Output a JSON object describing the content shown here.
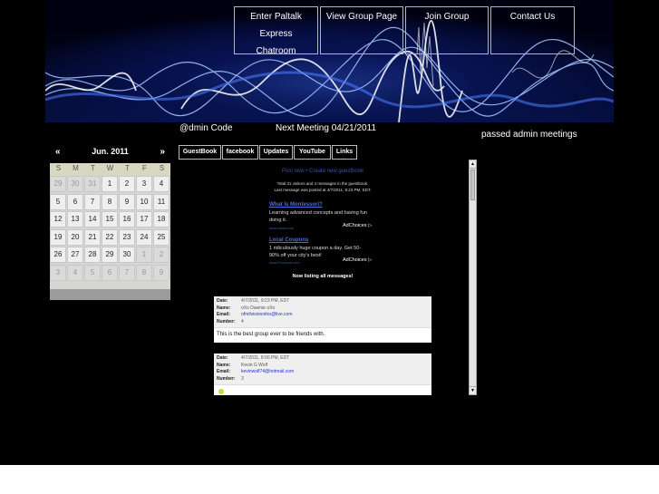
{
  "nav": [
    {
      "line1": "Enter Paltalk Express",
      "line2": "Chatroom"
    },
    {
      "line1": "View Group Page",
      "line2": ""
    },
    {
      "line1": "Join Group",
      "line2": ""
    },
    {
      "line1": "Contact Us",
      "line2": ""
    }
  ],
  "calendar": {
    "prev": "«",
    "next": "»",
    "title": "Jun. 2011",
    "weekdays": [
      "S",
      "M",
      "T",
      "W",
      "T",
      "F",
      "S"
    ],
    "weeks": [
      [
        {
          "d": "29",
          "o": true
        },
        {
          "d": "30",
          "o": true
        },
        {
          "d": "31",
          "o": true
        },
        {
          "d": "1"
        },
        {
          "d": "2"
        },
        {
          "d": "3"
        },
        {
          "d": "4"
        }
      ],
      [
        {
          "d": "5"
        },
        {
          "d": "6"
        },
        {
          "d": "7"
        },
        {
          "d": "8"
        },
        {
          "d": "9"
        },
        {
          "d": "10"
        },
        {
          "d": "11"
        }
      ],
      [
        {
          "d": "12"
        },
        {
          "d": "13"
        },
        {
          "d": "14"
        },
        {
          "d": "15"
        },
        {
          "d": "16"
        },
        {
          "d": "17"
        },
        {
          "d": "18"
        }
      ],
      [
        {
          "d": "19"
        },
        {
          "d": "20"
        },
        {
          "d": "21"
        },
        {
          "d": "22"
        },
        {
          "d": "23"
        },
        {
          "d": "24"
        },
        {
          "d": "25"
        }
      ],
      [
        {
          "d": "26"
        },
        {
          "d": "27"
        },
        {
          "d": "28"
        },
        {
          "d": "29"
        },
        {
          "d": "30"
        },
        {
          "d": "1",
          "o": true
        },
        {
          "d": "2",
          "o": true
        }
      ],
      [
        {
          "d": "3",
          "o": true
        },
        {
          "d": "4",
          "o": true
        },
        {
          "d": "5",
          "o": true
        },
        {
          "d": "6",
          "o": true
        },
        {
          "d": "7",
          "o": true
        },
        {
          "d": "8",
          "o": true
        },
        {
          "d": "9",
          "o": true
        }
      ]
    ]
  },
  "header": {
    "admin_code": "@dmin Code",
    "next_meeting": "Next Meeting 04/21/2011",
    "passed": "passed admin meetings"
  },
  "tabs": [
    "GuestBook",
    "facebook",
    "Updates",
    "YouTube",
    "Links"
  ],
  "guestbook": {
    "post_now": "Post now",
    "separator": " • ",
    "create_new": "Create new guestbook",
    "total_line": "Total 31 visitors and 4 messages in the guestbook.",
    "last_line": "Last message was posted at 4/7/2011, 9:23 PM, EDT.",
    "ads": [
      {
        "title": "What Is Montessori?",
        "body": "Learning advanced concepts and having fun doing it.",
        "url": "www.ahmm.net",
        "choices": "AdChoices ▷"
      },
      {
        "title": "Local Coupons",
        "body": "1 ridiculously huge coupon a day. Get 50-90% off your city's best!",
        "url": "www.Groupon.com",
        "choices": "AdChoices ▷"
      }
    ],
    "listing": "Now listing all messages!",
    "labels": {
      "date": "Date:",
      "name": "Name:",
      "email": "Email:",
      "number": "Number:"
    },
    "entries": [
      {
        "date": "4/7/2011, 9:23 PM, EDT",
        "name": "oXo Dawnie oXo",
        "email": "ofmilvisionnitro@live.com",
        "number": "4",
        "message": "This is the best group ever to be friends with."
      },
      {
        "date": "4/7/2011, 8:00 PM, EDT",
        "name": "Kevin G Wolf",
        "email": "kevinwolf74@hotmail.com",
        "number": "3",
        "message": ""
      }
    ]
  },
  "scrollbar": {
    "up": "▲",
    "down": "▼"
  },
  "colors": {
    "background": "#000000",
    "banner_glow": "#2f5cff",
    "link": "#3652a8"
  }
}
